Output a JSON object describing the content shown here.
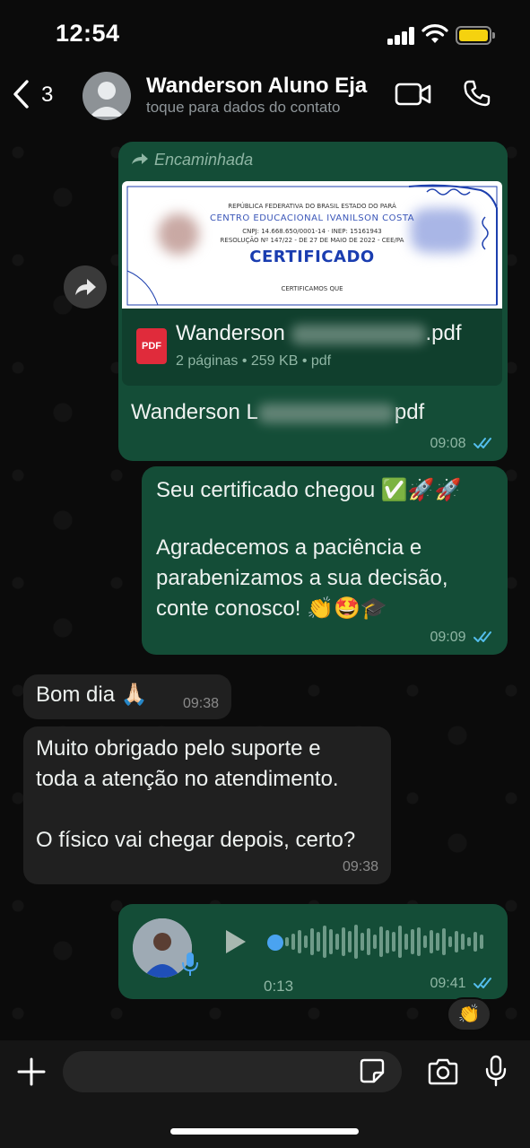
{
  "status_bar": {
    "time": "12:54"
  },
  "header": {
    "back_count": "3",
    "contact_name": "Wanderson Aluno Eja",
    "contact_subtitle": "toque para dados do contato"
  },
  "messages": {
    "forwarded": {
      "label": "Encaminhada",
      "preview": {
        "header_line": "REPÚBLICA FEDERATIVA DO BRASIL ESTADO DO PARÁ",
        "org": "CENTRO EDUCACIONAL IVANILSON COSTA",
        "ids": "CNPJ: 14.668.650/0001-14 · INEP: 15161943",
        "resolution": "RESOLUÇÃO Nº 147/22 - DE 27 DE MAIO DE 2022 - CEE/PA",
        "title": "CERTIFICADO",
        "footer": "CERTIFICAMOS QUE"
      },
      "file_name_start": "Wanderson",
      "file_name_end": ".pdf",
      "file_meta": "2 páginas • 259 KB • pdf",
      "pdf_badge": "PDF",
      "caption_start": "Wanderson L",
      "caption_end": "pdf",
      "time": "09:08"
    },
    "certificate_msg": {
      "line1": "Seu certificado chegou ✅🚀🚀",
      "line2": "Agradecemos a paciência e\nparabenizamos a sua decisão,\nconte conosco! 👏🤩🎓",
      "time": "09:09"
    },
    "greeting": {
      "text": "Bom dia 🙏🏻",
      "time": "09:38"
    },
    "thanks": {
      "text": "Muito obrigado pelo suporte e\ntoda a atenção no atendimento.\n\nO físico vai chegar depois, certo?",
      "time": "09:38"
    },
    "voice": {
      "duration": "0:13",
      "time": "09:41",
      "reaction": "👏"
    }
  },
  "colors": {
    "outgoing": "#144d37",
    "incoming": "#202020",
    "accent_blue": "#4aa3f0"
  }
}
